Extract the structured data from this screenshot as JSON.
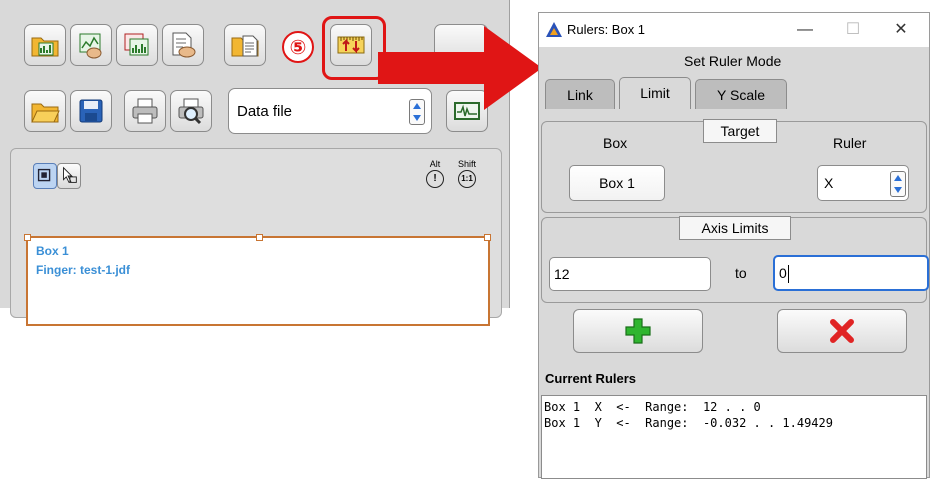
{
  "left_panel": {
    "step_marker": "⑤",
    "datafile_select": {
      "value": "Data file"
    },
    "modifier_keys": [
      {
        "label": "Alt",
        "symbol": "!"
      },
      {
        "label": "Shift",
        "symbol": "1:1"
      }
    ],
    "figure": {
      "box_label": "Box 1",
      "finger_label": "Finger: test-1.jdf"
    }
  },
  "dialog": {
    "title": "Rulers: Box 1",
    "window_controls": {
      "minimize": "—",
      "maximize": "☐",
      "close": "✕"
    },
    "mode_heading": "Set Ruler Mode",
    "tabs": [
      {
        "label": "Link",
        "active": false
      },
      {
        "label": "Limit",
        "active": true
      },
      {
        "label": "Y Scale",
        "active": false
      }
    ],
    "target": {
      "legend": "Target",
      "box_header": "Box",
      "ruler_header": "Ruler",
      "box_value": "Box 1",
      "ruler_value": "X"
    },
    "axis_limits": {
      "legend": "Axis Limits",
      "from_value": "12",
      "to_label": "to",
      "to_value": "0"
    },
    "current_rulers_heading": "Current Rulers",
    "current_rulers": [
      "Box 1  X  <-  Range:  12 . . 0",
      "Box 1  Y  <-  Range:  -0.032 . . 1.49429"
    ]
  },
  "colors": {
    "highlight_red": "#e01515",
    "link_blue": "#3a8fd6",
    "figure_border": "#c87533",
    "add_green": "#2fb52f",
    "delete_red": "#e02424"
  }
}
